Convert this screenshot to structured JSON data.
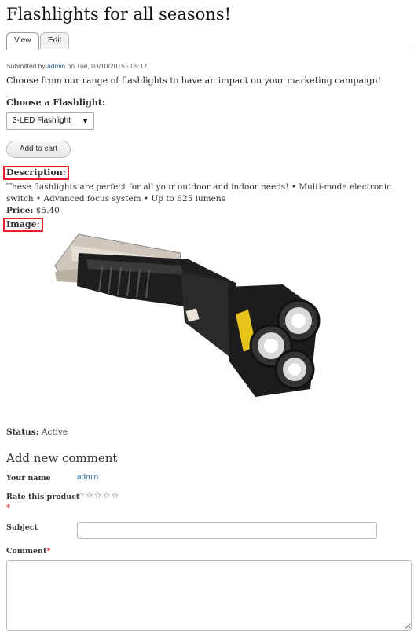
{
  "page": {
    "title": "Flashlights for all seasons!"
  },
  "tabs": [
    {
      "label": "View",
      "active": true
    },
    {
      "label": "Edit",
      "active": false
    }
  ],
  "meta": {
    "submitted_prefix": "Submitted by",
    "author": "admin",
    "submitted_suffix": "on Tue, 03/10/2015 - 05:17"
  },
  "intro": "Choose from our range of flashlights to have an impact on your marketing campaign!",
  "product": {
    "choose_label": "Choose a Flashlight:",
    "selected_option": "3-LED Flashlight",
    "add_to_cart": "Add to cart",
    "description_label": "Description:",
    "description": "These flashlights are perfect for all your outdoor and indoor needs! • Multi-mode electronic switch • Advanced focus system • Up to 625 lumens",
    "price_label": "Price:",
    "price": "$5.40",
    "image_label": "Image:",
    "status_label": "Status:",
    "status": "Active"
  },
  "comment_form": {
    "heading": "Add new comment",
    "name_label": "Your name",
    "name_value": "admin",
    "rating_label": "Rate this product",
    "stars": "☆☆☆☆☆",
    "required_mark": "*",
    "subject_label": "Subject",
    "subject_value": "",
    "comment_label": "Comment",
    "comment_value": ""
  },
  "colors": {
    "highlight": "#e0202b",
    "link": "#2a6496"
  }
}
